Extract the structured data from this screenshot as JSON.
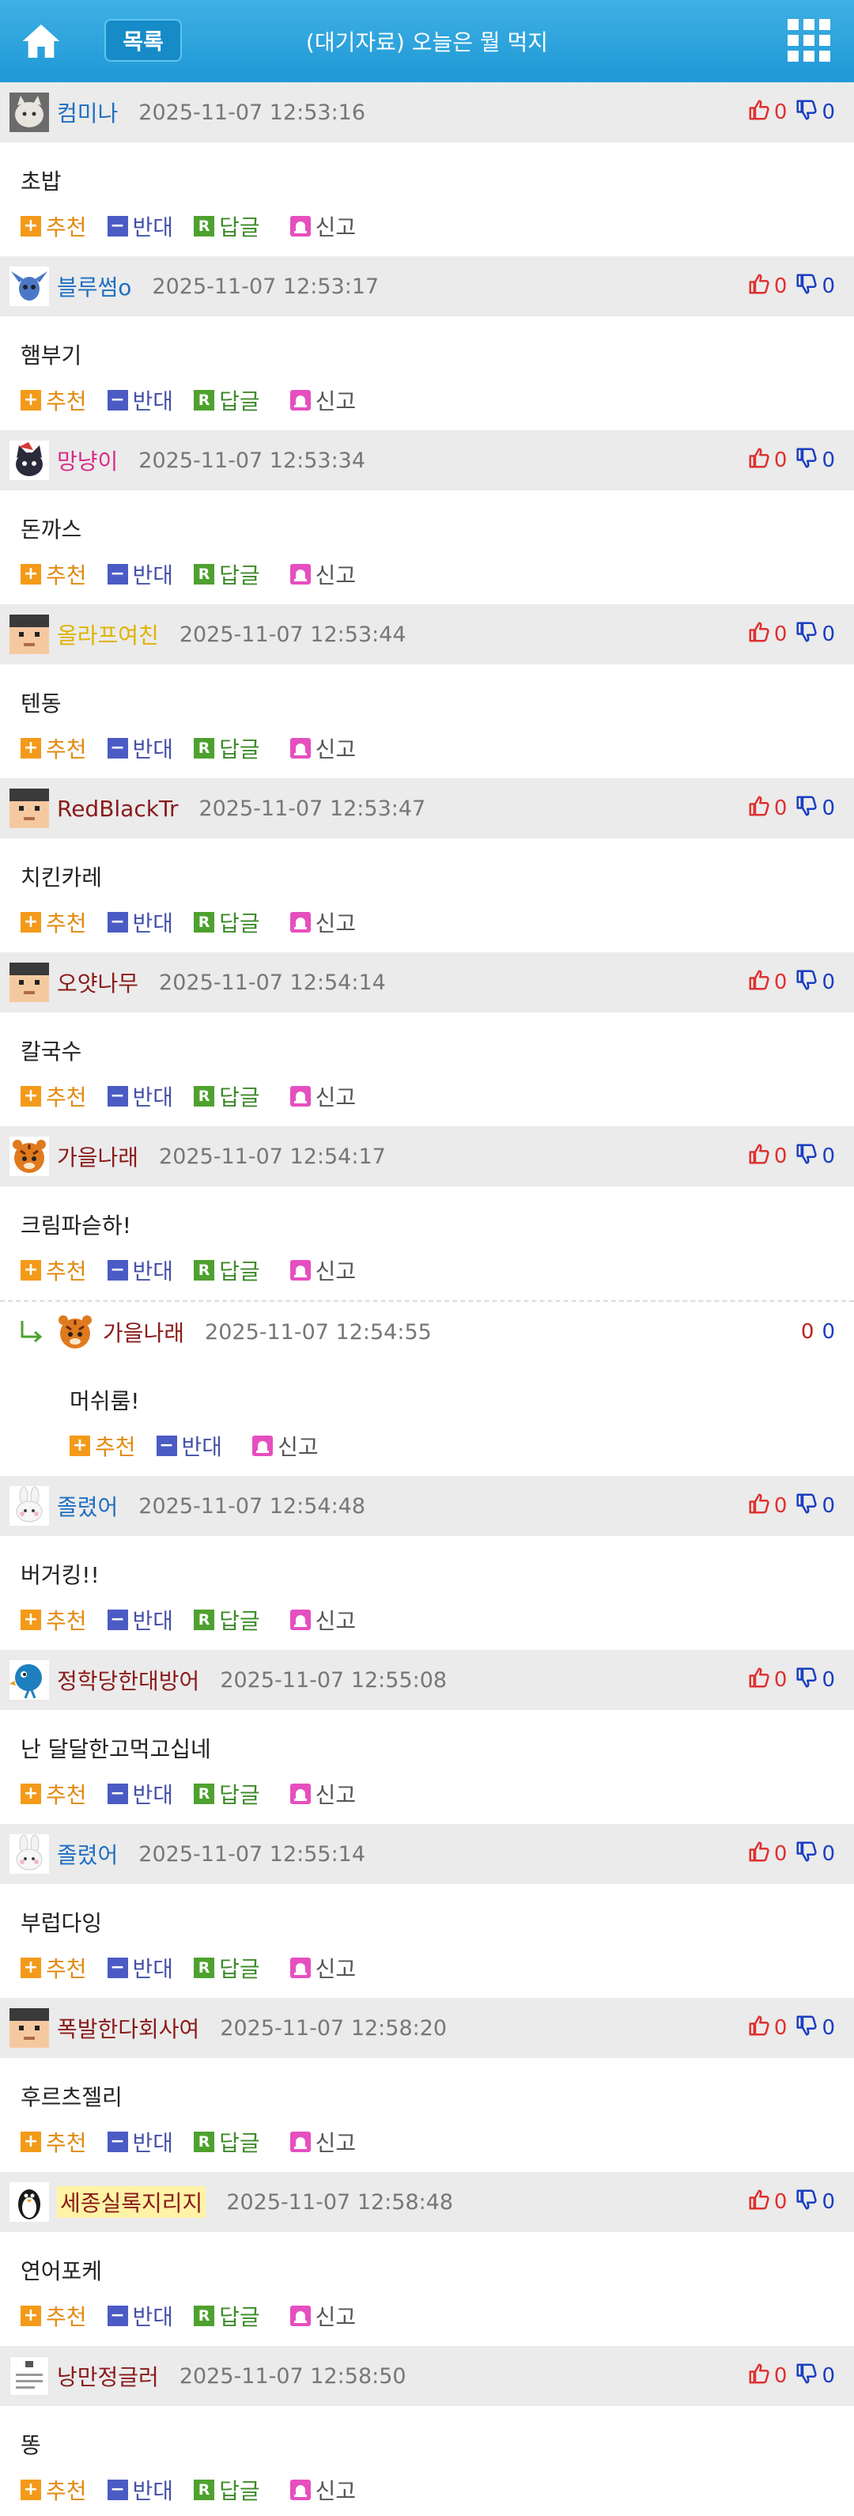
{
  "header": {
    "title": "(대기자료) 오늘은 뭘 먹지",
    "list_label": "목록"
  },
  "actions": {
    "recommend": "추천",
    "oppose": "반대",
    "reply": "답글",
    "report": "신고"
  },
  "colors": {
    "header": "#2aa3dc",
    "row_bg": "#ebebeb",
    "up": "#e03030",
    "down": "#1a3ec2"
  },
  "comments": [
    {
      "nick": "컴미나",
      "nick_color": "#1f6fc2",
      "time": "2025-11-07 12:53:16",
      "up": "0",
      "down": "0",
      "text": "초밥",
      "avatar": "cat-avatar"
    },
    {
      "nick": "블루썸o",
      "nick_color": "#1f6fc2",
      "time": "2025-11-07 12:53:17",
      "up": "0",
      "down": "0",
      "text": "햄부기",
      "avatar": "stitch-avatar"
    },
    {
      "nick": "망냥이",
      "nick_color": "#d82b8a",
      "time": "2025-11-07 12:53:34",
      "up": "0",
      "down": "0",
      "text": "돈까스",
      "avatar": "black-cat-avatar"
    },
    {
      "nick": "올라프여친",
      "nick_color": "#e0b300",
      "time": "2025-11-07 12:53:44",
      "up": "0",
      "down": "0",
      "text": "텐동",
      "avatar": "pixel-face-avatar"
    },
    {
      "nick": "RedBlackTr",
      "nick_color": "#8a1a1a",
      "time": "2025-11-07 12:53:47",
      "up": "0",
      "down": "0",
      "text": "치킨카레",
      "avatar": "pixel-face-avatar"
    },
    {
      "nick": "오얏나무",
      "nick_color": "#8a1a1a",
      "time": "2025-11-07 12:54:14",
      "up": "0",
      "down": "0",
      "text": "칼국수",
      "avatar": "pixel-face-avatar"
    },
    {
      "nick": "가을나래",
      "nick_color": "#8a1a1a",
      "time": "2025-11-07 12:54:17",
      "up": "0",
      "down": "0",
      "text": "크림파슫하!",
      "avatar": "tiger-avatar",
      "reply": {
        "nick": "가을나래",
        "nick_color": "#8a1a1a",
        "time": "2025-11-07 12:54:55",
        "up": "0",
        "down": "0",
        "text": "머쉬룸!",
        "avatar": "tiger-avatar"
      }
    },
    {
      "nick": "졸렸어",
      "nick_color": "#1f6fc2",
      "time": "2025-11-07 12:54:48",
      "up": "0",
      "down": "0",
      "text": "버거킹!!",
      "avatar": "rabbit-avatar"
    },
    {
      "nick": "정학당한대방어",
      "nick_color": "#8a1a1a",
      "time": "2025-11-07 12:55:08",
      "up": "0",
      "down": "0",
      "text": "난 달달한고먹고십네",
      "avatar": "blue-bird-avatar"
    },
    {
      "nick": "졸렸어",
      "nick_color": "#1f6fc2",
      "time": "2025-11-07 12:55:14",
      "up": "0",
      "down": "0",
      "text": "부럽다잉",
      "avatar": "rabbit-avatar"
    },
    {
      "nick": "폭발한다회사여",
      "nick_color": "#8a1a1a",
      "time": "2025-11-07 12:58:20",
      "up": "0",
      "down": "0",
      "text": "후르츠젤리",
      "avatar": "pixel-face-avatar"
    },
    {
      "nick": "세종실록지리지",
      "nick_color": "#8a1a1a",
      "highlight": true,
      "time": "2025-11-07 12:58:48",
      "up": "0",
      "down": "0",
      "text": "연어포케",
      "avatar": "penguin-avatar"
    },
    {
      "nick": "낭만정글러",
      "nick_color": "#8a1a1a",
      "time": "2025-11-07 12:58:50",
      "up": "0",
      "down": "0",
      "text": "똥",
      "avatar": "text-card-avatar"
    }
  ]
}
